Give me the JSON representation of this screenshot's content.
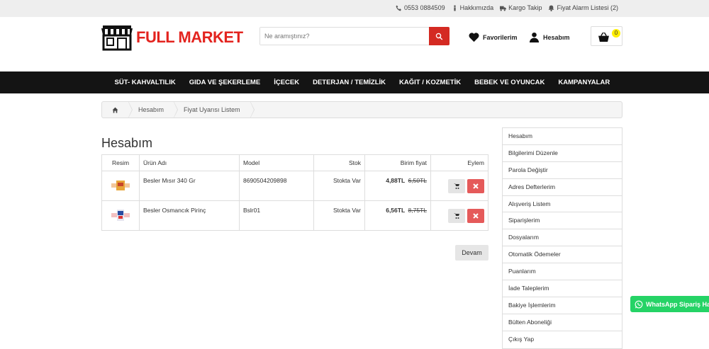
{
  "topbar": {
    "phone": "0553 0884509",
    "about": "Hakkımızda",
    "shipping": "Kargo Takip",
    "price_alarm": "Fiyat Alarm Listesi (2)"
  },
  "header": {
    "logo_text": "FULL MARKET",
    "search_placeholder": "Ne aramıştınız?",
    "favorites": "Favorilerim",
    "account": "Hesabım",
    "cart_count": "0"
  },
  "nav": {
    "items": [
      "SÜT- KAHVALTILIK",
      "GIDA VE ŞEKERLEME",
      "İÇECEK",
      "DETERJAN / TEMİZLİK",
      "KAĞIT / KOZMETİK",
      "BEBEK VE OYUNCAK",
      "KAMPANYALAR"
    ]
  },
  "breadcrumb": {
    "items": [
      "Hesabım",
      "Fiyat Uyarısı Listem"
    ]
  },
  "main": {
    "title": "Hesabım",
    "table": {
      "headers": [
        "Resim",
        "Ürün Adı",
        "Model",
        "Stok",
        "Birim fiyat",
        "Eylem"
      ],
      "rows": [
        {
          "name": "Besler Mısır 340 Gr",
          "model": "8690504209898",
          "stock": "Stokta Var",
          "price_new": "4,88TL",
          "price_old": "6,50TL"
        },
        {
          "name": "Besler Osmancık Pirinç",
          "model": "Bslr01",
          "stock": "Stokta Var",
          "price_new": "6,56TL",
          "price_old": "8,75TL"
        }
      ]
    },
    "continue_label": "Devam"
  },
  "sidebar": {
    "items": [
      "Hesabım",
      "Bilgilerimi Düzenle",
      "Parola Değiştir",
      "Adres Defterlerim",
      "Alışveriş Listem",
      "Siparişlerim",
      "Dosyalarım",
      "Otomatik Ödemeler",
      "Puanlarım",
      "İade Taleplerim",
      "Bakiye İşlemlerim",
      "Bülten Aboneliği",
      "Çıkış Yap"
    ]
  },
  "whatsapp": {
    "label": "WhatsApp Sipariş Hattı"
  },
  "colors": {
    "accent_red": "#d42a22",
    "nav_bg": "#141414",
    "whatsapp_green": "#25d366",
    "badge_yellow": "#ffee00"
  }
}
